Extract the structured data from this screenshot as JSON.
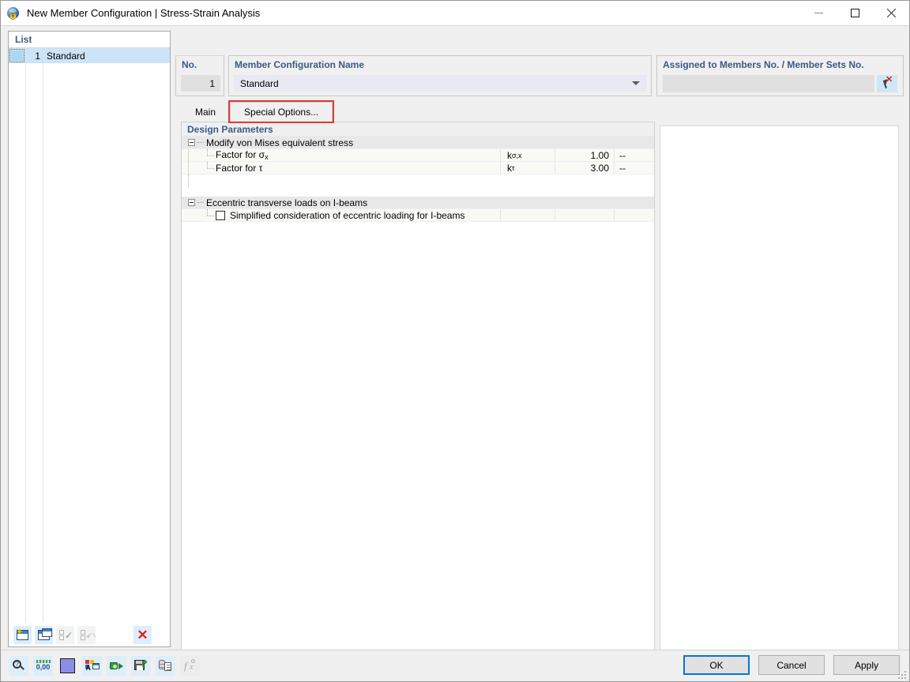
{
  "window": {
    "title": "New Member Configuration | Stress-Strain Analysis",
    "icon": "globe-icon",
    "minimize_label": "—",
    "maximize_label": "□",
    "close_label": "✕"
  },
  "list_panel": {
    "header": "List",
    "rows": [
      {
        "no": "1",
        "name": "Standard",
        "selected": true
      }
    ],
    "toolbar": [
      {
        "name": "new-configuration-button",
        "icon": "new-window-icon",
        "enabled": true
      },
      {
        "name": "copy-configuration-button",
        "icon": "duplicate-window-icon",
        "enabled": true
      },
      {
        "name": "select-all-button",
        "icon": "checkbox-check-icon",
        "enabled": false
      },
      {
        "name": "invert-selection-button",
        "icon": "checkbox-swap-icon",
        "enabled": false
      },
      {
        "name": "delete-configuration-button",
        "icon": "red-x-icon",
        "enabled": true
      }
    ]
  },
  "header": {
    "no_label": "No.",
    "no_value": "1",
    "name_label": "Member Configuration Name",
    "name_value": "Standard",
    "assigned_label": "Assigned to Members No. / Member Sets No.",
    "assigned_value": "",
    "assigned_placeholder": "",
    "pick_button_icon": "pick-cursor-icon"
  },
  "tabs": [
    {
      "label": "Main",
      "active": false,
      "highlighted": false
    },
    {
      "label": "Special Options...",
      "active": true,
      "highlighted": true
    }
  ],
  "content": {
    "section_title": "Design Parameters",
    "groups": [
      {
        "title": "Modify von Mises equivalent stress",
        "expanded": true,
        "rows": [
          {
            "label": "Factor for σx",
            "label_base": "Factor for σ",
            "label_sub": "x",
            "symbol_base": "k",
            "symbol_sub": "σ,x",
            "value": "1.00",
            "unit": "--",
            "type": "value"
          },
          {
            "label": "Factor for τ",
            "label_base": "Factor for τ",
            "label_sub": "",
            "symbol_base": "k",
            "symbol_sub": "τ",
            "value": "3.00",
            "unit": "--",
            "type": "value"
          }
        ]
      },
      {
        "title": "Eccentric transverse loads on I-beams",
        "expanded": true,
        "rows": [
          {
            "label": "Simplified consideration of eccentric loading for I-beams",
            "label_base": "Simplified consideration of eccentric loading for I-beams",
            "label_sub": "",
            "symbol_base": "",
            "symbol_sub": "",
            "value": "",
            "unit": "",
            "type": "checkbox",
            "checked": false
          }
        ]
      }
    ]
  },
  "bottom_toolbar": [
    {
      "name": "info-button",
      "icon": "magnifier-question-icon",
      "enabled": true
    },
    {
      "name": "units-button",
      "icon": "units-decimal-icon",
      "enabled": true
    },
    {
      "name": "color-button",
      "icon": "color-swatch-icon",
      "enabled": true
    },
    {
      "name": "display-properties-button",
      "icon": "colors-label-icon",
      "enabled": true
    },
    {
      "name": "import-button",
      "icon": "green-link-arrow-icon",
      "enabled": true
    },
    {
      "name": "save-configuration-button",
      "icon": "floppy-save-icon",
      "enabled": true
    },
    {
      "name": "database-button",
      "icon": "database-document-icon",
      "enabled": true
    },
    {
      "name": "formula-button",
      "icon": "fx-formula-icon",
      "enabled": false
    }
  ],
  "dialog_buttons": [
    {
      "name": "ok-button",
      "label": "OK",
      "primary": true
    },
    {
      "name": "cancel-button",
      "label": "Cancel",
      "primary": false
    },
    {
      "name": "apply-button",
      "label": "Apply",
      "primary": false
    }
  ],
  "colors": {
    "accent_header_text": "#3b5a84",
    "selection": "#cce4f7",
    "highlight_outline": "#e03a30",
    "focus_border": "#0078d7",
    "delete_red": "#e02020",
    "window_bg": "#f0f0f0"
  }
}
